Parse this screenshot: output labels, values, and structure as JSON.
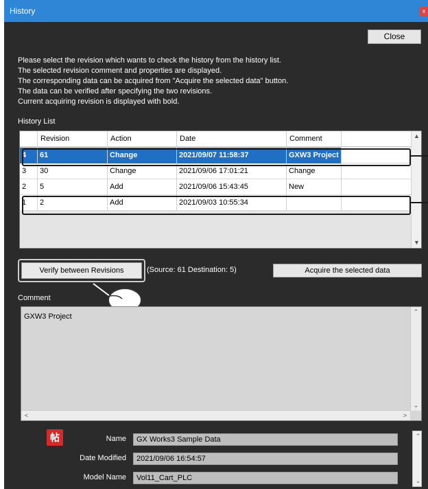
{
  "window": {
    "title": "History",
    "title_close": "x",
    "close_label": "Close"
  },
  "instructions": [
    "Please select the revision which wants to check the history from the history list.",
    "The selected revision comment and properties are displayed.",
    "The corresponding data can be acquired from \"Acquire the selected data\" button.",
    "The data can be verified after specifying the two revisions.",
    "Current acquiring revision is displayed with bold."
  ],
  "history": {
    "label": "History List",
    "columns": [
      "Revision",
      "Action",
      "Date",
      "Comment"
    ],
    "rows": [
      {
        "index": "4",
        "revision": "61",
        "action": "Change",
        "date": "2021/09/07 11:58:37",
        "comment": "GXW3 Project",
        "selected": true
      },
      {
        "index": "3",
        "revision": "30",
        "action": "Change",
        "date": "2021/09/06 17:01:21",
        "comment": "Change"
      },
      {
        "index": "2",
        "revision": "5",
        "action": "Add",
        "date": "2021/09/06 15:43:45",
        "comment": "New"
      },
      {
        "index": "1",
        "revision": "2",
        "action": "Add",
        "date": "2021/09/03 10:55:34",
        "comment": ""
      }
    ]
  },
  "actions": {
    "verify_label": "Verify between Revisions",
    "source_dest": "(Source: 61 Destination: 5)",
    "acquire_label": "Acquire the selected data"
  },
  "comment": {
    "label": "Comment",
    "text": "GXW3 Project"
  },
  "properties": {
    "app_icon_glyph": "帖",
    "name_label": "Name",
    "name_value": "GX Works3 Sample Data",
    "date_label": "Date Modified",
    "date_value": "2021/09/06 16:54:57",
    "model_label": "Model Name",
    "model_value": "Vol11_Cart_PLC"
  },
  "colors": {
    "titlebar": "#2f85d6",
    "background": "#2b2b2b",
    "selection": "#1f6fc5",
    "app_icon": "#d42a2a"
  }
}
